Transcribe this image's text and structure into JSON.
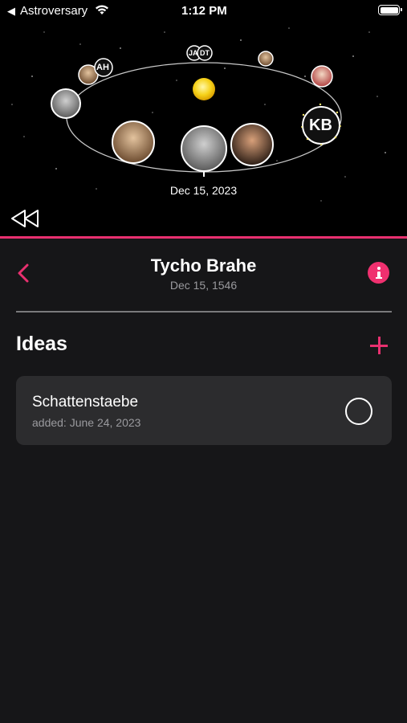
{
  "status_bar": {
    "back_glyph": "◀",
    "app_name": "Astroversary",
    "time": "1:12 PM",
    "wifi_icon": "wifi-icon",
    "battery_icon": "battery-icon"
  },
  "orbit": {
    "date_label": "Dec 15, 2023",
    "markers": [
      {
        "initials": "AH"
      },
      {
        "initials": "JA"
      },
      {
        "initials": "DT"
      },
      {
        "initials": "KB"
      }
    ],
    "rewind_icon": "rewind-icon"
  },
  "header": {
    "title": "Tycho Brahe",
    "subtitle": "Dec 15, 1546",
    "back_icon": "chevron-left-icon",
    "info_icon": "info-icon"
  },
  "ideas": {
    "section_title": "Ideas",
    "add_icon": "plus-icon",
    "items": [
      {
        "title": "Schattenstaebe",
        "added": "added: June 24, 2023"
      }
    ]
  },
  "colors": {
    "accent": "#e8306f",
    "background": "#161618",
    "card": "#2c2c2e",
    "secondary_text": "#9a9a9e"
  }
}
